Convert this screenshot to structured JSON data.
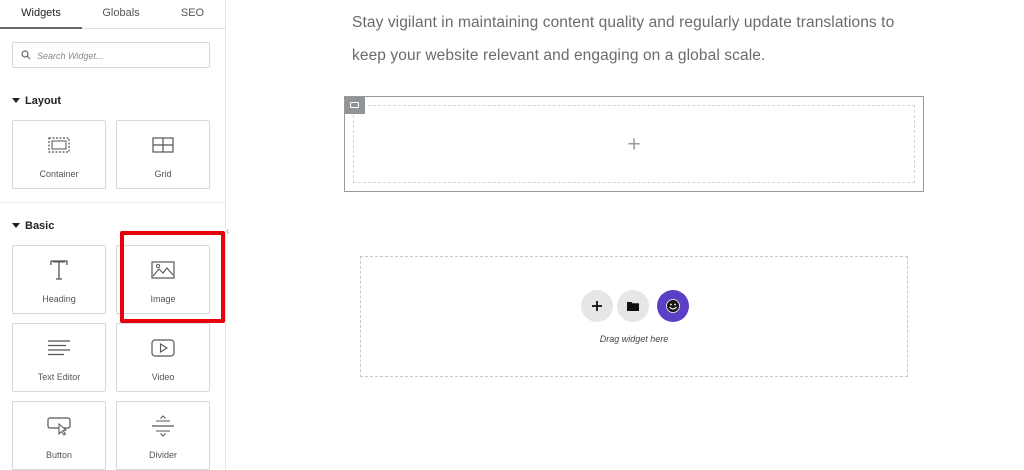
{
  "sidebar": {
    "tabs": [
      {
        "label": "Widgets"
      },
      {
        "label": "Globals"
      },
      {
        "label": "SEO"
      }
    ],
    "search": {
      "placeholder": "Search Widget..."
    },
    "sections": [
      {
        "title": "Layout",
        "widgets": [
          {
            "label": "Container",
            "icon": "container-icon"
          },
          {
            "label": "Grid",
            "icon": "grid-icon"
          }
        ]
      },
      {
        "title": "Basic",
        "widgets": [
          {
            "label": "Heading",
            "icon": "heading-icon"
          },
          {
            "label": "Image",
            "icon": "image-icon"
          },
          {
            "label": "Text Editor",
            "icon": "text-editor-icon"
          },
          {
            "label": "Video",
            "icon": "video-icon"
          },
          {
            "label": "Button",
            "icon": "button-icon"
          },
          {
            "label": "Divider",
            "icon": "divider-icon"
          }
        ]
      }
    ],
    "collapse_glyph": "‹"
  },
  "canvas": {
    "paragraph_lines": [
      "Stay vigilant in maintaining content quality and regularly update translations to",
      "keep your website relevant and engaging on a global scale."
    ],
    "container_plus": "+",
    "drop_zone": {
      "text": "Drag widget here",
      "buttons": [
        {
          "icon": "plus-icon"
        },
        {
          "icon": "folder-icon"
        },
        {
          "icon": "ai-assistant-icon"
        }
      ]
    }
  },
  "colors": {
    "highlight": "#e8000d",
    "accent_purple": "#5b3fc4",
    "button_grey": "#e6e6e6"
  }
}
